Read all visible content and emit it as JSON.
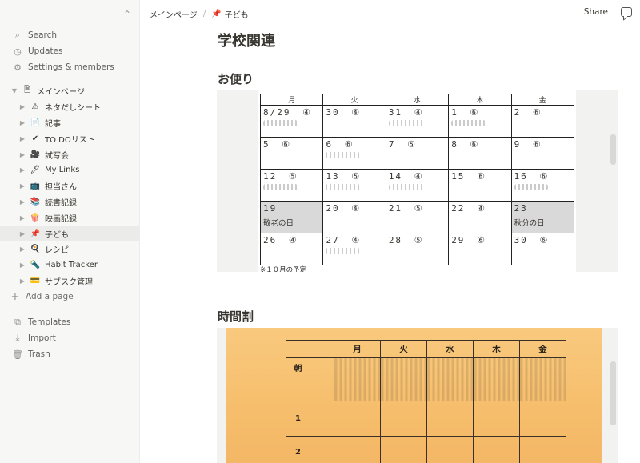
{
  "sidebar": {
    "top_items": [
      {
        "label": "Search",
        "icon": "search-icon"
      },
      {
        "label": "Updates",
        "icon": "clock-icon"
      },
      {
        "label": "Settings & members",
        "icon": "gear-icon"
      }
    ],
    "root_page": "メインページ",
    "pages": [
      {
        "label": "ネタだしシート",
        "icon": "⚠"
      },
      {
        "label": "記事",
        "icon": "📄"
      },
      {
        "label": "TO DOリスト",
        "icon": "✔"
      },
      {
        "label": "試写会",
        "icon": "🎥"
      },
      {
        "label": "My Links",
        "icon": "🖊"
      },
      {
        "label": "担当さん",
        "icon": "📺"
      },
      {
        "label": "読書記録",
        "icon": "📚"
      },
      {
        "label": "映画記録",
        "icon": "🍿"
      },
      {
        "label": "子ども",
        "icon": "📌",
        "active": true
      },
      {
        "label": "レシピ",
        "icon": "🍳"
      },
      {
        "label": "Habit Tracker",
        "icon": "🔦"
      },
      {
        "label": "サブスク管理",
        "icon": "💳"
      }
    ],
    "add_page": "Add a page",
    "bottom_items": [
      {
        "label": "Templates",
        "icon": "templates-icon"
      },
      {
        "label": "Import",
        "icon": "import-icon"
      },
      {
        "label": "Trash",
        "icon": "trash-icon"
      }
    ]
  },
  "topbar": {
    "crumb_root": "メインページ",
    "crumb_sep": "/",
    "crumb_current_icon": "📌",
    "crumb_current": "子ども",
    "share_label": "Share"
  },
  "page": {
    "title": "学校関連",
    "section1": "お便り",
    "section2": "時間割"
  },
  "calendar": {
    "headers": [
      "月",
      "火",
      "水",
      "木",
      "金"
    ],
    "rows": [
      [
        {
          "d": "8/29",
          "m": "④",
          "s": true
        },
        {
          "d": "30",
          "m": "④"
        },
        {
          "d": "31",
          "m": "④",
          "s": true
        },
        {
          "d": "1",
          "m": "⑥",
          "s": true
        },
        {
          "d": "2",
          "m": "⑥"
        }
      ],
      [
        {
          "d": "5",
          "m": "⑥"
        },
        {
          "d": "6",
          "m": "⑥",
          "s": true
        },
        {
          "d": "7",
          "m": "⑤"
        },
        {
          "d": "8",
          "m": "⑥"
        },
        {
          "d": "9",
          "m": "⑥"
        }
      ],
      [
        {
          "d": "12",
          "m": "⑤",
          "s": true
        },
        {
          "d": "13",
          "m": "⑤",
          "s": true
        },
        {
          "d": "14",
          "m": "④",
          "s": true
        },
        {
          "d": "15",
          "m": "⑥"
        },
        {
          "d": "16",
          "m": "⑥",
          "s": true
        }
      ],
      [
        {
          "d": "19",
          "m": "",
          "note": "敬老の日",
          "gray": true
        },
        {
          "d": "20",
          "m": "④"
        },
        {
          "d": "21",
          "m": "⑤"
        },
        {
          "d": "22",
          "m": "④"
        },
        {
          "d": "23",
          "m": "",
          "note": "秋分の日",
          "gray": true
        }
      ],
      [
        {
          "d": "26",
          "m": "④"
        },
        {
          "d": "27",
          "m": "④",
          "s": true
        },
        {
          "d": "28",
          "m": "⑤"
        },
        {
          "d": "29",
          "m": "⑥"
        },
        {
          "d": "30",
          "m": "⑥"
        }
      ]
    ],
    "footnote": "※１０月の予定"
  },
  "timetable": {
    "headers": [
      "",
      "",
      "月",
      "火",
      "水",
      "木",
      "金"
    ],
    "rows": [
      "朝",
      "",
      "1",
      "2"
    ]
  }
}
